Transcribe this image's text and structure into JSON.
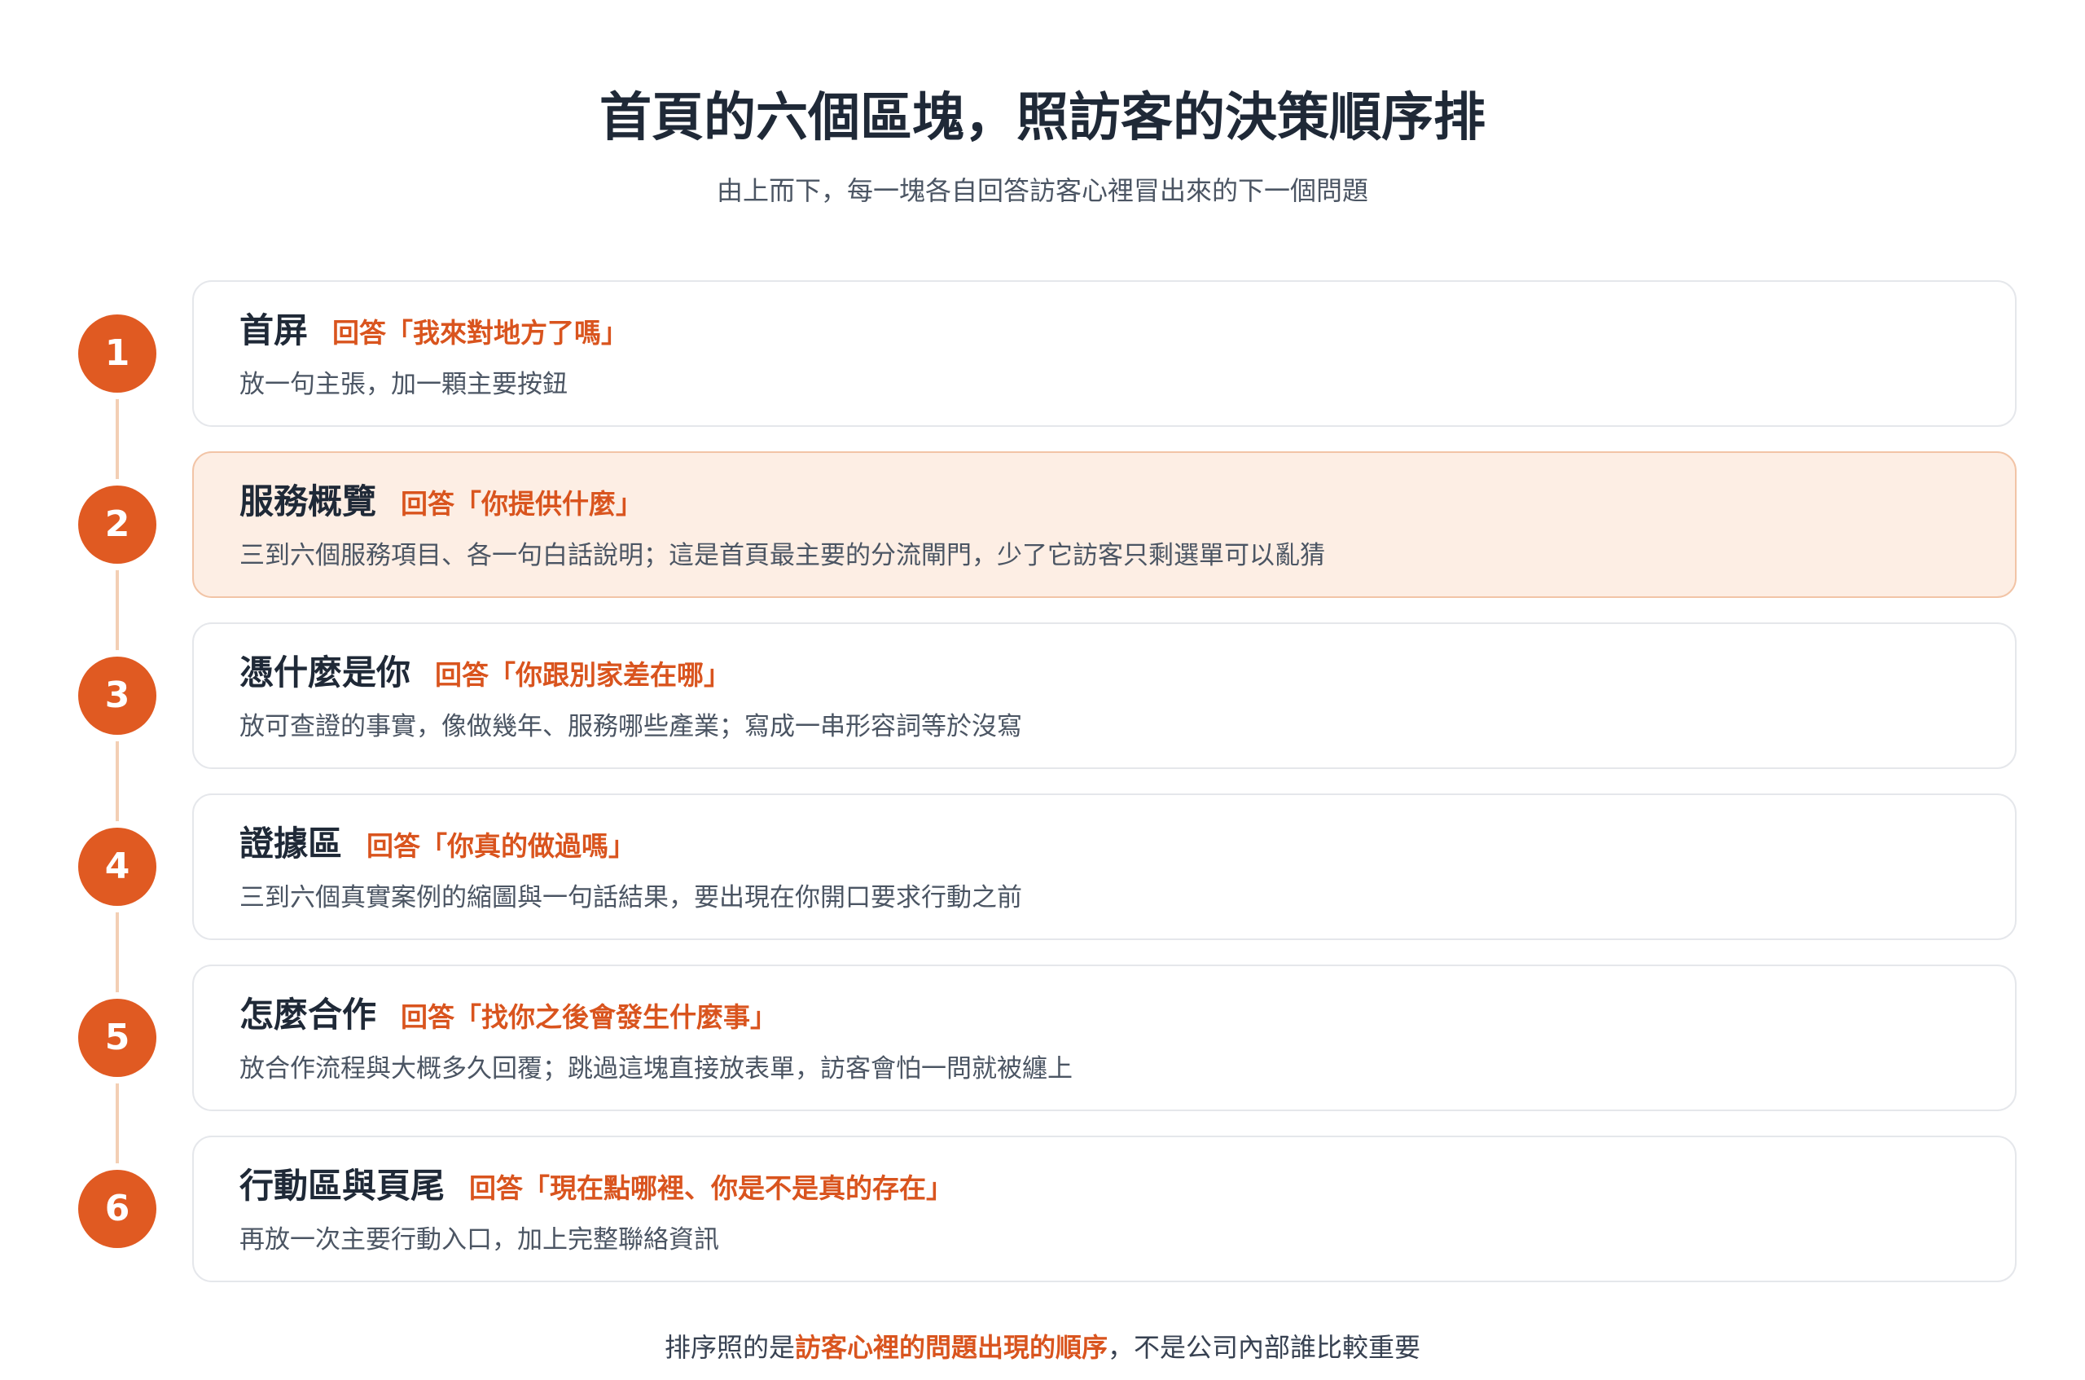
{
  "title": "首頁的六個區塊，照訪客的決策順序排",
  "subtitle": "由上而下，每一塊各自回答訪客心裡冒出來的下一個問題",
  "colors": {
    "accent": "#e05a22",
    "highlight_bg": "#fdeee4"
  },
  "steps": [
    {
      "number": "1",
      "name": "首屏",
      "question": "回答「我來對地方了嗎」",
      "description": "放一句主張，加一顆主要按鈕"
    },
    {
      "number": "2",
      "name": "服務概覽",
      "question": "回答「你提供什麼」",
      "description": "三到六個服務項目、各一句白話說明；這是首頁最主要的分流閘門，少了它訪客只剩選單可以亂猜"
    },
    {
      "number": "3",
      "name": "憑什麼是你",
      "question": "回答「你跟別家差在哪」",
      "description": "放可查證的事實，像做幾年、服務哪些產業；寫成一串形容詞等於沒寫"
    },
    {
      "number": "4",
      "name": "證據區",
      "question": "回答「你真的做過嗎」",
      "description": "三到六個真實案例的縮圖與一句話結果，要出現在你開口要求行動之前"
    },
    {
      "number": "5",
      "name": "怎麼合作",
      "question": "回答「找你之後會發生什麼事」",
      "description": "放合作流程與大概多久回覆；跳過這塊直接放表單，訪客會怕一問就被纏上"
    },
    {
      "number": "6",
      "name": "行動區與頁尾",
      "question": "回答「現在點哪裡、你是不是真的存在」",
      "description": "再放一次主要行動入口，加上完整聯絡資訊"
    }
  ],
  "highlighted_step": "2",
  "footer": {
    "prefix": "排序照的是",
    "emphasis": "訪客心裡的問題出現的順序",
    "suffix": "，不是公司內部誰比較重要"
  }
}
